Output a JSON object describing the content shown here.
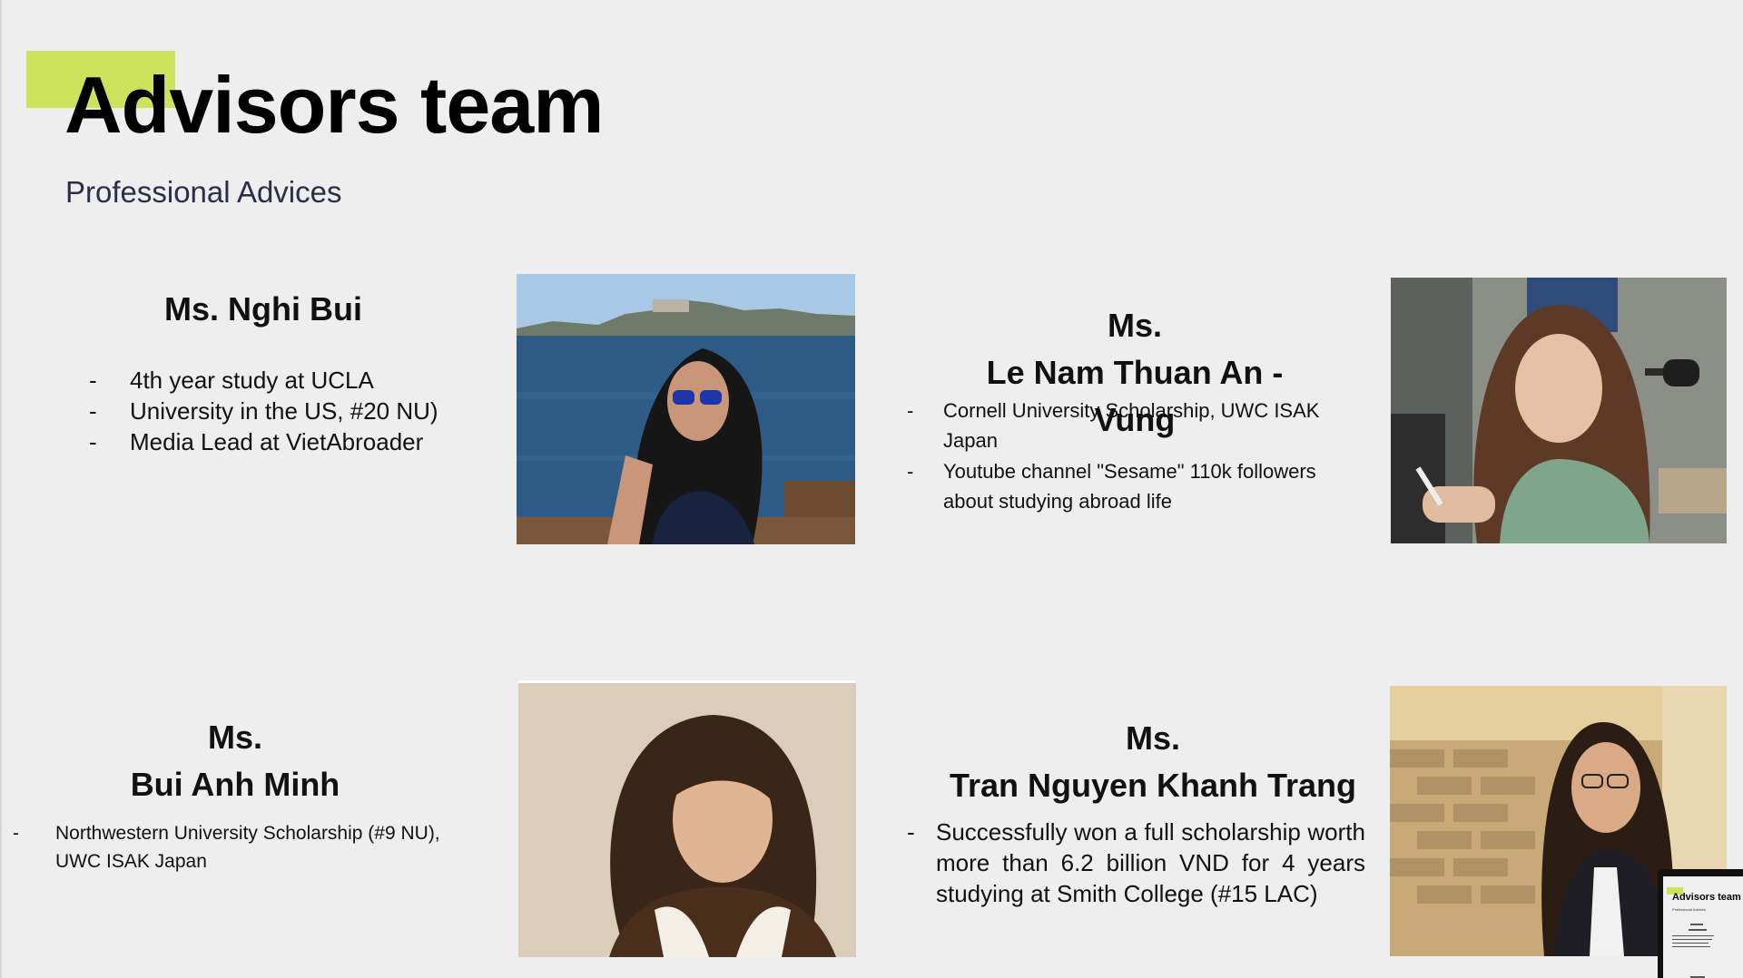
{
  "slide": {
    "title": "Advisors team",
    "subtitle": "Professional Advices",
    "accent_color": "#cce35b",
    "background_color": "#eeeeee"
  },
  "advisors": [
    {
      "name": "Ms. Nghi Bui",
      "bullets": [
        "4th year study at UCLA",
        "University in the US, #20 NU)",
        "Media Lead at VietAbroader"
      ],
      "photo": "portrait with sunglasses by the bay"
    },
    {
      "name_line1": "Ms.",
      "name_line2": "Le Nam Thuan An - Vung",
      "bullets": [
        "Cornell University Scholarship, UWC ISAK Japan",
        "Youtube channel \"Sesame\" 110k followers about studying abroad life"
      ],
      "photo": "portrait at desk holding a pen"
    },
    {
      "name_line1": "Ms.",
      "name_line2": "Bui Anh Minh",
      "bullets": [
        "Northwestern University Scholarship (#9 NU), UWC ISAK Japan"
      ],
      "photo": "portrait in sherpa jacket"
    },
    {
      "name_line1": "Ms.",
      "name_line2": "Tran Nguyen Khanh Trang",
      "bullets": [
        "Successfully won a full scholarship worth more than 6.2 billion VND for 4 years studying at Smith College (#15 LAC)"
      ],
      "photo": "portrait with glasses by brick wall"
    }
  ],
  "bullet_marker": "-",
  "thumbnail": {
    "title": "Advisors team",
    "subtitle": "Professional Advices"
  }
}
